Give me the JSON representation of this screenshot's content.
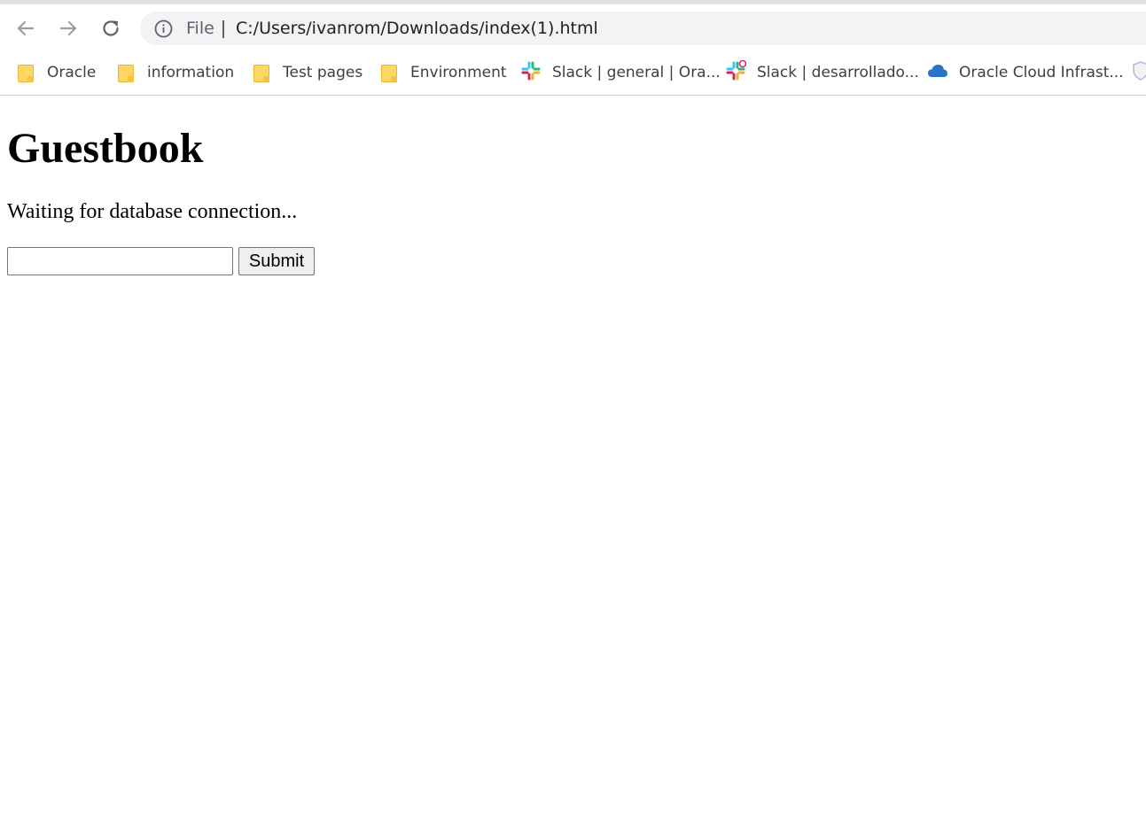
{
  "browser": {
    "omnibox": {
      "scheme_label": "File",
      "url": "C:/Users/ivanrom/Downloads/index(1).html"
    },
    "bookmarks": [
      {
        "label": "Oracle",
        "icon": "folder-icon"
      },
      {
        "label": "information",
        "icon": "folder-icon"
      },
      {
        "label": "Test pages",
        "icon": "folder-icon"
      },
      {
        "label": "Environment",
        "icon": "folder-icon"
      },
      {
        "label": "Slack | general | Ora...",
        "icon": "slack-icon"
      },
      {
        "label": "Slack | desarrollado...",
        "icon": "slack-icon"
      },
      {
        "label": "Oracle Cloud Infrast...",
        "icon": "cloud-icon"
      }
    ]
  },
  "page": {
    "title": "Guestbook",
    "status": "Waiting for database connection...",
    "entry_value": "",
    "submit_label": "Submit"
  },
  "colors": {
    "omnibox_bg": "#f1f3f4",
    "folder": "#fdd663",
    "cloud": "#2a73c8"
  }
}
